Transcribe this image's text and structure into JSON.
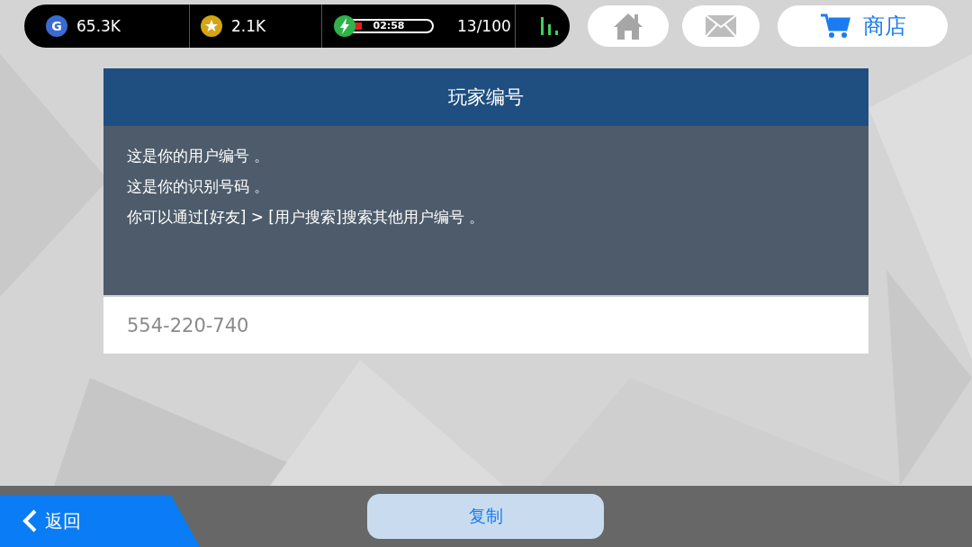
{
  "status_bar": {
    "gems_icon_letter": "G",
    "gems": "65.3K",
    "coins": "2.1K",
    "energy_timer": "02:58",
    "energy_bar": {
      "level": 0.08
    },
    "energy": "13/100"
  },
  "nav": {
    "shop": "商店"
  },
  "dialog": {
    "title": "玩家编号",
    "lines": [
      "这是你的用户编号 。",
      "这是你的识别号码 。",
      "你可以通过[好友] > [用户搜索]搜索其他用户编号 。"
    ],
    "player_id": "554-220-740"
  },
  "footer": {
    "back": "返回",
    "copy": "复制"
  }
}
